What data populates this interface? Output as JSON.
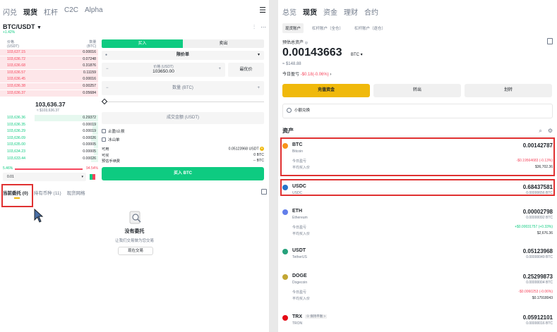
{
  "left": {
    "nav": [
      "闪兑",
      "现货",
      "杠杆",
      "C2C",
      "Alpha"
    ],
    "nav_active": "现货",
    "pair": "BTC/USDT",
    "change": "+1.42%",
    "ob_header": {
      "price": "价格",
      "price_unit": "(USDT)",
      "qty": "数量",
      "qty_unit": "(BTC)"
    },
    "asks": [
      {
        "p": "103,637.15",
        "q": "0.00016"
      },
      {
        "p": "103,636.72",
        "q": "0.07248"
      },
      {
        "p": "103,636.68",
        "q": "0.31876"
      },
      {
        "p": "103,636.57",
        "q": "0.11159"
      },
      {
        "p": "103,636.45",
        "q": "0.00016"
      },
      {
        "p": "103,636.38",
        "q": "0.00257"
      },
      {
        "p": "103,636.37",
        "q": "0.05684"
      }
    ],
    "mid_price": "103,636.37",
    "mid_usd": "≈ $103,636.37",
    "bids": [
      {
        "p": "103,636.36",
        "q": "0.29372"
      },
      {
        "p": "103,636.35",
        "q": "0.00019"
      },
      {
        "p": "103,636.29",
        "q": "0.00019"
      },
      {
        "p": "103,636.09",
        "q": "0.00026"
      },
      {
        "p": "103,635.00",
        "q": "0.00005"
      },
      {
        "p": "103,634.23",
        "q": "0.00005"
      },
      {
        "p": "103,633.44",
        "q": "0.00026"
      }
    ],
    "ratio_buy": "5.46%",
    "ratio_sell": "94.54%",
    "depth": "0.01",
    "side_buy": "买入",
    "side_sell": "卖出",
    "order_type": "限价单",
    "price_label": "价格 (USDT)",
    "price_value": "103650.00",
    "best_price": "最优价",
    "qty_placeholder": "数量 (BTC)",
    "total_placeholder": "成交金额 (USDT)",
    "opt_tpsl": "止盈/止损",
    "opt_iceberg": "冰山单",
    "avail_label": "可用",
    "avail_value": "0.05123968 USDT",
    "buyable_label": "可买",
    "buyable_value": "0 BTC",
    "fee_label": "预估手续费",
    "fee_value": "-- BTC",
    "buy_button": "买入 BTC",
    "order_tabs": [
      "当前委托 (0)",
      "持有币种 (11)",
      "现货网格"
    ],
    "empty_title": "没有委托",
    "empty_sub": "让我们交易做为您交易",
    "empty_button": "现在交易"
  },
  "right": {
    "nav": [
      "总览",
      "现货",
      "资金",
      "理财",
      "合约"
    ],
    "nav_active": "现货",
    "account_tabs": [
      "现货账户",
      "杠杆账户（全仓）",
      "杠杆账户（逐仓）"
    ],
    "est_label": "预估总资产",
    "balance": "0.00143663",
    "balance_unit": "BTC ▾",
    "balance_usd": "≈ $148.88",
    "pnl_label": "今日盈亏",
    "pnl_value": "-$0.18(-0.06%)",
    "btn_deposit": "充值资金",
    "btn_withdraw": "转出",
    "btn_transfer": "划转",
    "small_exchange": "小额兑换",
    "assets_title": "资产",
    "pnl_row_label": "今日盈亏",
    "avg_row_label": "平均买入价",
    "assets": [
      {
        "sym": "BTC",
        "name": "Bitcoin",
        "amt": "0.00142787",
        "sub": "",
        "pnl": "-$0.19564683 (-0.13%)",
        "pnl_sign": "neg",
        "avg": "$36,702.36",
        "color": "#f7931a"
      },
      {
        "sym": "USDC",
        "name": "USDC",
        "amt": "0.68437581",
        "sub": "0.00000656 BTC",
        "pnl": "",
        "pnl_sign": "",
        "avg": "",
        "color": "#2775ca"
      },
      {
        "sym": "ETH",
        "name": "Ethereum",
        "amt": "0.00002798",
        "sub": "0.00000092 BTC",
        "pnl": "+$0.00031757 (+0.33%)",
        "pnl_sign": "pos",
        "avg": "$2,676.36",
        "color": "#627eea"
      },
      {
        "sym": "USDT",
        "name": "TetherUS",
        "amt": "0.05123968",
        "sub": "0.00000049 BTC",
        "pnl": "",
        "pnl_sign": "",
        "avg": "",
        "color": "#26a17b"
      },
      {
        "sym": "DOGE",
        "name": "Dogecoin",
        "amt": "0.25299873",
        "sub": "0.00000004 BTC",
        "pnl": "-$0.0060253 (-0.06%)",
        "pnl_sign": "neg",
        "avg": "$0.17918043",
        "color": "#c2a633"
      },
      {
        "sym": "TRX",
        "name": "TRON",
        "tag": "① 保持平衡 >",
        "amt": "0.05912101",
        "sub": "0.00000016 BTC",
        "pnl": "",
        "pnl_sign": "",
        "avg": "",
        "color": "#e50915"
      }
    ]
  }
}
